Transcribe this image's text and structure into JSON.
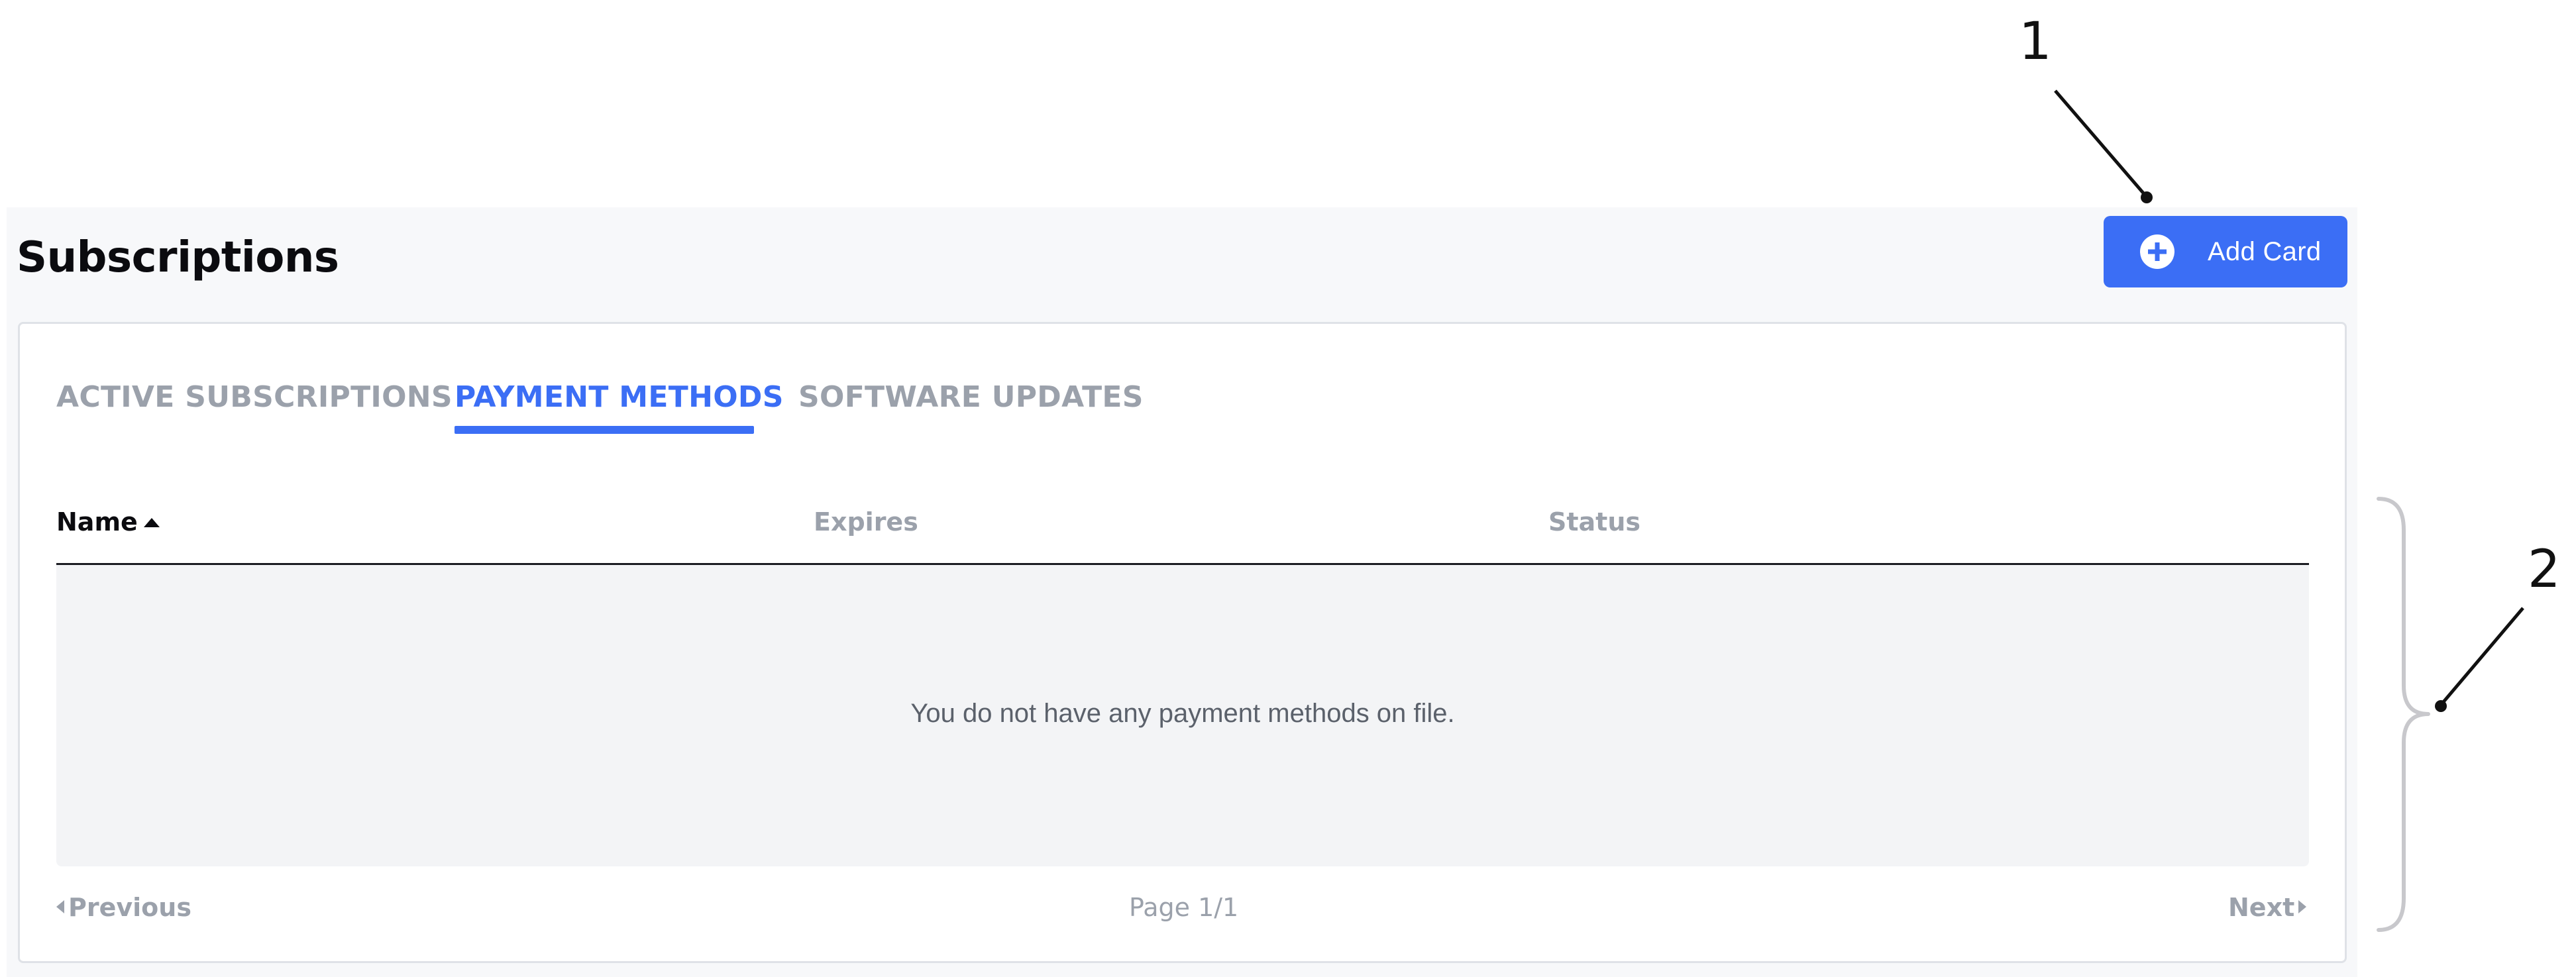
{
  "page": {
    "title": "Subscriptions"
  },
  "toolbar": {
    "add_card_label": "Add Card"
  },
  "tabs": [
    {
      "label": "ACTIVE SUBSCRIPTIONS",
      "active": false
    },
    {
      "label": "PAYMENT METHODS",
      "active": true
    },
    {
      "label": "SOFTWARE UPDATES",
      "active": false
    }
  ],
  "table": {
    "columns": [
      "Name",
      "Expires",
      "Status"
    ],
    "sort_column": "Name",
    "sort_direction": "ascending",
    "empty_message": "You do not have any payment methods on file."
  },
  "pagination": {
    "previous_label": "Previous",
    "page_label": "Page 1/1",
    "next_label": "Next"
  },
  "callouts": [
    "1",
    "2"
  ],
  "colors": {
    "accent": "#3b6ef5",
    "muted_text": "#9ba1ab",
    "panel_bg": "#f7f8fa",
    "empty_bg": "#f3f4f6"
  }
}
